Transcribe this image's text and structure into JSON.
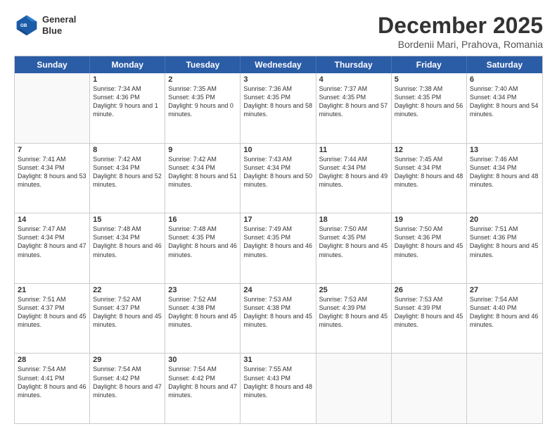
{
  "header": {
    "logo_line1": "General",
    "logo_line2": "Blue",
    "month": "December 2025",
    "location": "Bordenii Mari, Prahova, Romania"
  },
  "weekdays": [
    "Sunday",
    "Monday",
    "Tuesday",
    "Wednesday",
    "Thursday",
    "Friday",
    "Saturday"
  ],
  "rows": [
    [
      {
        "day": "",
        "empty": true
      },
      {
        "day": "1",
        "sunrise": "Sunrise: 7:34 AM",
        "sunset": "Sunset: 4:36 PM",
        "daylight": "Daylight: 9 hours and 1 minute."
      },
      {
        "day": "2",
        "sunrise": "Sunrise: 7:35 AM",
        "sunset": "Sunset: 4:35 PM",
        "daylight": "Daylight: 9 hours and 0 minutes."
      },
      {
        "day": "3",
        "sunrise": "Sunrise: 7:36 AM",
        "sunset": "Sunset: 4:35 PM",
        "daylight": "Daylight: 8 hours and 58 minutes."
      },
      {
        "day": "4",
        "sunrise": "Sunrise: 7:37 AM",
        "sunset": "Sunset: 4:35 PM",
        "daylight": "Daylight: 8 hours and 57 minutes."
      },
      {
        "day": "5",
        "sunrise": "Sunrise: 7:38 AM",
        "sunset": "Sunset: 4:35 PM",
        "daylight": "Daylight: 8 hours and 56 minutes."
      },
      {
        "day": "6",
        "sunrise": "Sunrise: 7:40 AM",
        "sunset": "Sunset: 4:34 PM",
        "daylight": "Daylight: 8 hours and 54 minutes."
      }
    ],
    [
      {
        "day": "7",
        "sunrise": "Sunrise: 7:41 AM",
        "sunset": "Sunset: 4:34 PM",
        "daylight": "Daylight: 8 hours and 53 minutes."
      },
      {
        "day": "8",
        "sunrise": "Sunrise: 7:42 AM",
        "sunset": "Sunset: 4:34 PM",
        "daylight": "Daylight: 8 hours and 52 minutes."
      },
      {
        "day": "9",
        "sunrise": "Sunrise: 7:42 AM",
        "sunset": "Sunset: 4:34 PM",
        "daylight": "Daylight: 8 hours and 51 minutes."
      },
      {
        "day": "10",
        "sunrise": "Sunrise: 7:43 AM",
        "sunset": "Sunset: 4:34 PM",
        "daylight": "Daylight: 8 hours and 50 minutes."
      },
      {
        "day": "11",
        "sunrise": "Sunrise: 7:44 AM",
        "sunset": "Sunset: 4:34 PM",
        "daylight": "Daylight: 8 hours and 49 minutes."
      },
      {
        "day": "12",
        "sunrise": "Sunrise: 7:45 AM",
        "sunset": "Sunset: 4:34 PM",
        "daylight": "Daylight: 8 hours and 48 minutes."
      },
      {
        "day": "13",
        "sunrise": "Sunrise: 7:46 AM",
        "sunset": "Sunset: 4:34 PM",
        "daylight": "Daylight: 8 hours and 48 minutes."
      }
    ],
    [
      {
        "day": "14",
        "sunrise": "Sunrise: 7:47 AM",
        "sunset": "Sunset: 4:34 PM",
        "daylight": "Daylight: 8 hours and 47 minutes."
      },
      {
        "day": "15",
        "sunrise": "Sunrise: 7:48 AM",
        "sunset": "Sunset: 4:34 PM",
        "daylight": "Daylight: 8 hours and 46 minutes."
      },
      {
        "day": "16",
        "sunrise": "Sunrise: 7:48 AM",
        "sunset": "Sunset: 4:35 PM",
        "daylight": "Daylight: 8 hours and 46 minutes."
      },
      {
        "day": "17",
        "sunrise": "Sunrise: 7:49 AM",
        "sunset": "Sunset: 4:35 PM",
        "daylight": "Daylight: 8 hours and 46 minutes."
      },
      {
        "day": "18",
        "sunrise": "Sunrise: 7:50 AM",
        "sunset": "Sunset: 4:35 PM",
        "daylight": "Daylight: 8 hours and 45 minutes."
      },
      {
        "day": "19",
        "sunrise": "Sunrise: 7:50 AM",
        "sunset": "Sunset: 4:36 PM",
        "daylight": "Daylight: 8 hours and 45 minutes."
      },
      {
        "day": "20",
        "sunrise": "Sunrise: 7:51 AM",
        "sunset": "Sunset: 4:36 PM",
        "daylight": "Daylight: 8 hours and 45 minutes."
      }
    ],
    [
      {
        "day": "21",
        "sunrise": "Sunrise: 7:51 AM",
        "sunset": "Sunset: 4:37 PM",
        "daylight": "Daylight: 8 hours and 45 minutes."
      },
      {
        "day": "22",
        "sunrise": "Sunrise: 7:52 AM",
        "sunset": "Sunset: 4:37 PM",
        "daylight": "Daylight: 8 hours and 45 minutes."
      },
      {
        "day": "23",
        "sunrise": "Sunrise: 7:52 AM",
        "sunset": "Sunset: 4:38 PM",
        "daylight": "Daylight: 8 hours and 45 minutes."
      },
      {
        "day": "24",
        "sunrise": "Sunrise: 7:53 AM",
        "sunset": "Sunset: 4:38 PM",
        "daylight": "Daylight: 8 hours and 45 minutes."
      },
      {
        "day": "25",
        "sunrise": "Sunrise: 7:53 AM",
        "sunset": "Sunset: 4:39 PM",
        "daylight": "Daylight: 8 hours and 45 minutes."
      },
      {
        "day": "26",
        "sunrise": "Sunrise: 7:53 AM",
        "sunset": "Sunset: 4:39 PM",
        "daylight": "Daylight: 8 hours and 45 minutes."
      },
      {
        "day": "27",
        "sunrise": "Sunrise: 7:54 AM",
        "sunset": "Sunset: 4:40 PM",
        "daylight": "Daylight: 8 hours and 46 minutes."
      }
    ],
    [
      {
        "day": "28",
        "sunrise": "Sunrise: 7:54 AM",
        "sunset": "Sunset: 4:41 PM",
        "daylight": "Daylight: 8 hours and 46 minutes."
      },
      {
        "day": "29",
        "sunrise": "Sunrise: 7:54 AM",
        "sunset": "Sunset: 4:42 PM",
        "daylight": "Daylight: 8 hours and 47 minutes."
      },
      {
        "day": "30",
        "sunrise": "Sunrise: 7:54 AM",
        "sunset": "Sunset: 4:42 PM",
        "daylight": "Daylight: 8 hours and 47 minutes."
      },
      {
        "day": "31",
        "sunrise": "Sunrise: 7:55 AM",
        "sunset": "Sunset: 4:43 PM",
        "daylight": "Daylight: 8 hours and 48 minutes."
      },
      {
        "day": "",
        "empty": true
      },
      {
        "day": "",
        "empty": true
      },
      {
        "day": "",
        "empty": true
      }
    ]
  ]
}
